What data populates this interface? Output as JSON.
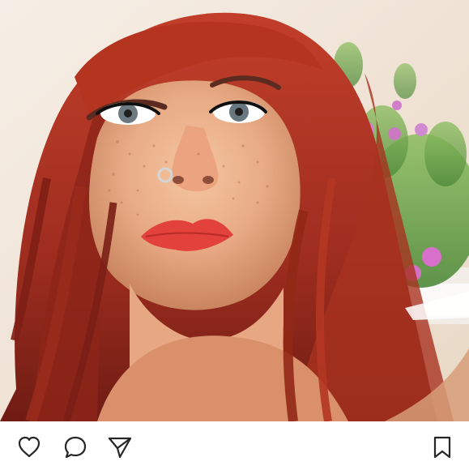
{
  "post": {
    "photo": {
      "alt_semantic": "selfie-photo"
    },
    "actions": {
      "like_icon": "heart-outline-icon",
      "comment_icon": "speech-bubble-icon",
      "share_icon": "paper-plane-icon",
      "save_icon": "bookmark-outline-icon"
    }
  },
  "colors": {
    "icon_stroke": "#262626",
    "background": "#ffffff"
  }
}
